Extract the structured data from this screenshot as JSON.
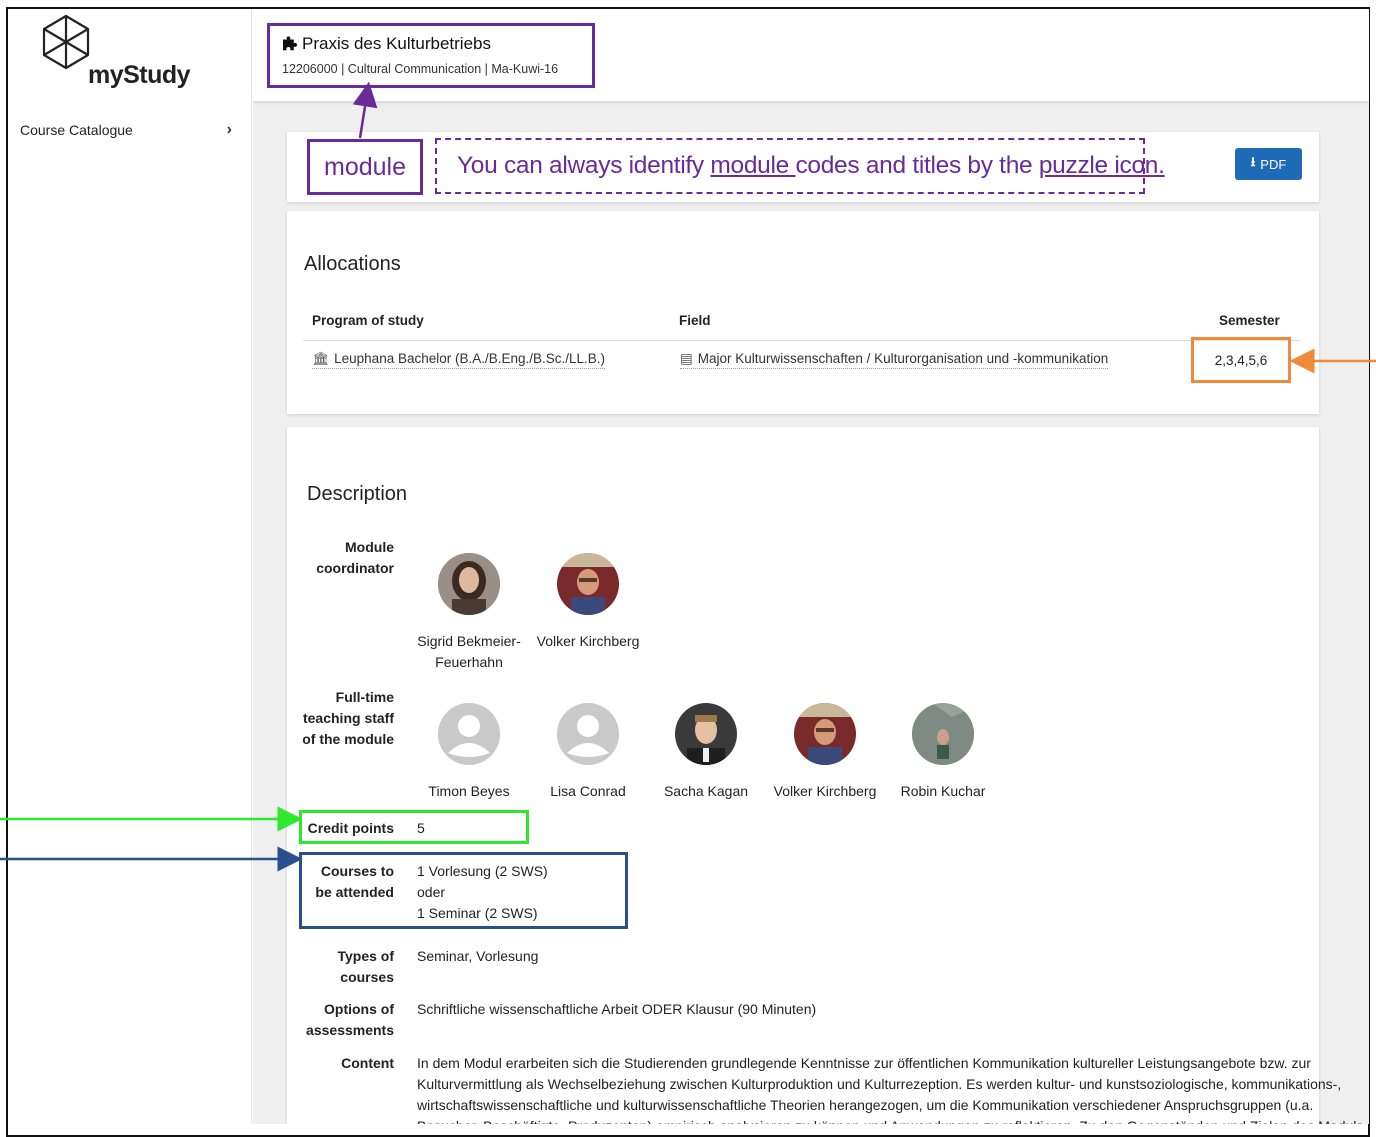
{
  "app": {
    "name": "myStudy"
  },
  "sidebar": {
    "items": [
      {
        "label": "Course Catalogue",
        "chevron": "›"
      }
    ]
  },
  "header": {
    "module_title": "Praxis des Kulturbetriebs",
    "module_subtitle": "12206000 | Cultural Communication | Ma-Kuwi-16",
    "module_icon": "puzzle-icon"
  },
  "annotations": {
    "module_label": "module",
    "hint_parts": [
      "You can always identify ",
      "module ",
      "codes and titles by the ",
      "puzzle icon."
    ],
    "colors": {
      "module": "#6a2b9a",
      "semester": "#f08a3a",
      "credit": "#2ee82e",
      "courses": "#2a4f8f"
    }
  },
  "toolbar": {
    "pdf_label": "PDF",
    "pdf_icon": "download-icon"
  },
  "allocations": {
    "title": "Allocations",
    "columns": [
      "Program of study",
      "Field",
      "Semester"
    ],
    "rows": [
      {
        "program": "Leuphana Bachelor (B.A./B.Eng./B.Sc./LL.B.)",
        "program_icon": "institution-icon",
        "field": "Major Kulturwissenschaften / Kulturorganisation und -kommunikation",
        "field_icon": "list-icon",
        "semester": "2,3,4,5,6"
      }
    ]
  },
  "description": {
    "title": "Description",
    "coordinator_label": "Module coordinator",
    "coordinators": [
      {
        "name": "Sigrid Bekmeier-Feuerhahn",
        "line1": "Sigrid Bekmeier-",
        "line2": "Feuerhahn",
        "photo": "photo"
      },
      {
        "name": "Volker Kirchberg",
        "line1": "Volker Kirchberg",
        "line2": "",
        "photo": "photo"
      }
    ],
    "staff_label": "Full-time teaching staff of the module",
    "staff": [
      {
        "name": "Timon Beyes",
        "photo": "default"
      },
      {
        "name": "Lisa Conrad",
        "photo": "default"
      },
      {
        "name": "Sacha Kagan",
        "photo": "photo"
      },
      {
        "name": "Volker Kirchberg",
        "photo": "photo"
      },
      {
        "name": "Robin Kuchar",
        "photo": "photo"
      }
    ],
    "credit_label": "Credit points",
    "credit_value": "5",
    "courses_label": "Courses to be attended",
    "courses_lines": [
      "1 Vorlesung (2 SWS)",
      "oder",
      "1 Seminar (2 SWS)"
    ],
    "types_label": "Types of courses",
    "types_value": "Seminar, Vorlesung",
    "assessment_label": "Options of assessments",
    "assessment_value": "Schriftliche wissenschaftliche Arbeit ODER Klausur (90 Minuten)",
    "content_label": "Content",
    "content_lines": [
      "In dem Modul erarbeiten sich die Studierenden grundlegende Kenntnisse zur öffentlichen Kommunikation kultureller Leistungsangebote bzw. zur",
      "Kulturvermittlung als Wechselbeziehung zwischen Kulturproduktion und Kulturrezeption. Es werden kultur- und kunstsoziologische, kommunikations-,",
      "wirtschaftswissenschaftliche und kulturwissenschaftliche Theorien herangezogen, um die Kommunikation verschiedener Anspruchsgruppen (u.a.",
      "Besucher, Beschäftigte, Produzenten) empirisch analysieren zu können und Anwendungen zu reflektieren. Zu den Gegenständen und Zielen des Moduls"
    ]
  }
}
